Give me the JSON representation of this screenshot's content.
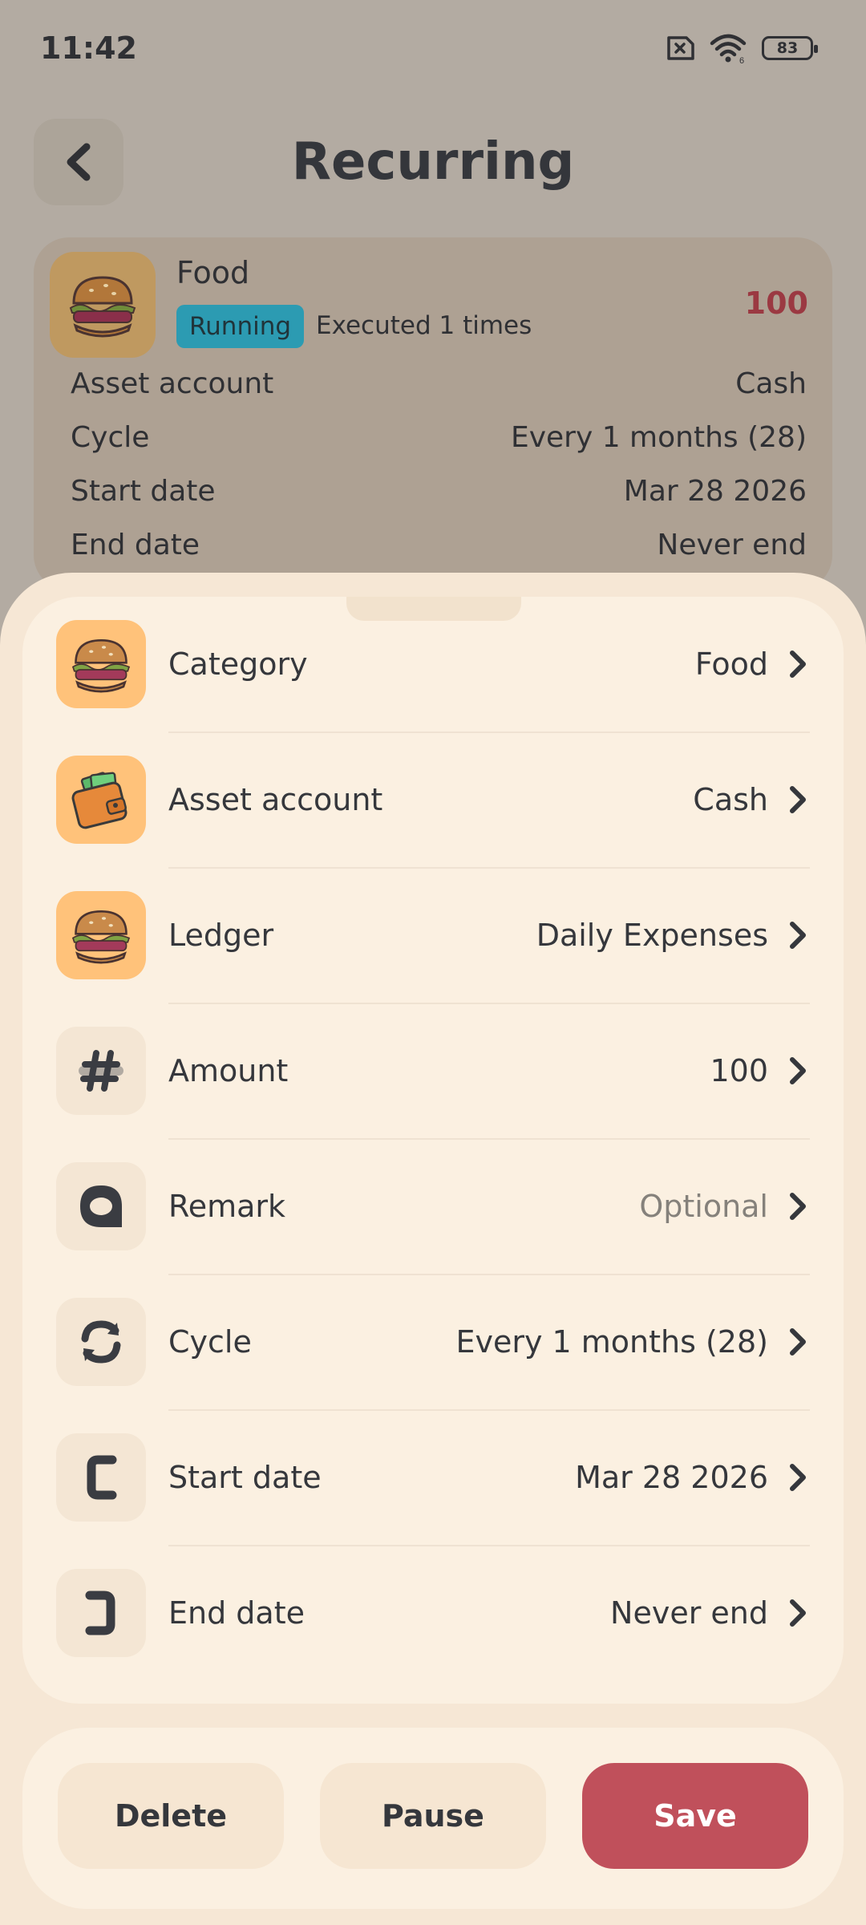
{
  "status_bar": {
    "time": "11:42",
    "battery": "83",
    "wifi_sub": "6"
  },
  "header": {
    "title": "Recurring"
  },
  "summary": {
    "category": "Food",
    "status": "Running",
    "executed": "Executed 1 times",
    "amount": "100",
    "rows": [
      {
        "label": "Asset account",
        "value": "Cash"
      },
      {
        "label": "Cycle",
        "value": "Every 1 months (28)"
      },
      {
        "label": "Start date",
        "value": "Mar 28 2026"
      },
      {
        "label": "End date",
        "value": "Never end"
      }
    ]
  },
  "form": {
    "rows": [
      {
        "label": "Category",
        "value": "Food",
        "icon": "burger-icon"
      },
      {
        "label": "Asset account",
        "value": "Cash",
        "icon": "wallet-icon"
      },
      {
        "label": "Ledger",
        "value": "Daily Expenses",
        "icon": "burger-icon"
      },
      {
        "label": "Amount",
        "value": "100",
        "icon": "hash-icon"
      },
      {
        "label": "Remark",
        "value": "Optional",
        "icon": "remark-icon"
      },
      {
        "label": "Cycle",
        "value": "Every 1 months (28)",
        "icon": "cycle-icon"
      },
      {
        "label": "Start date",
        "value": "Mar 28 2026",
        "icon": "start-date-icon"
      },
      {
        "label": "End date",
        "value": "Never end",
        "icon": "end-date-icon"
      }
    ]
  },
  "actions": {
    "delete": "Delete",
    "pause": "Pause",
    "save": "Save"
  },
  "colors": {
    "accent": "#c0505b",
    "badge": "#2c9bb2",
    "amount": "#9b3942"
  }
}
